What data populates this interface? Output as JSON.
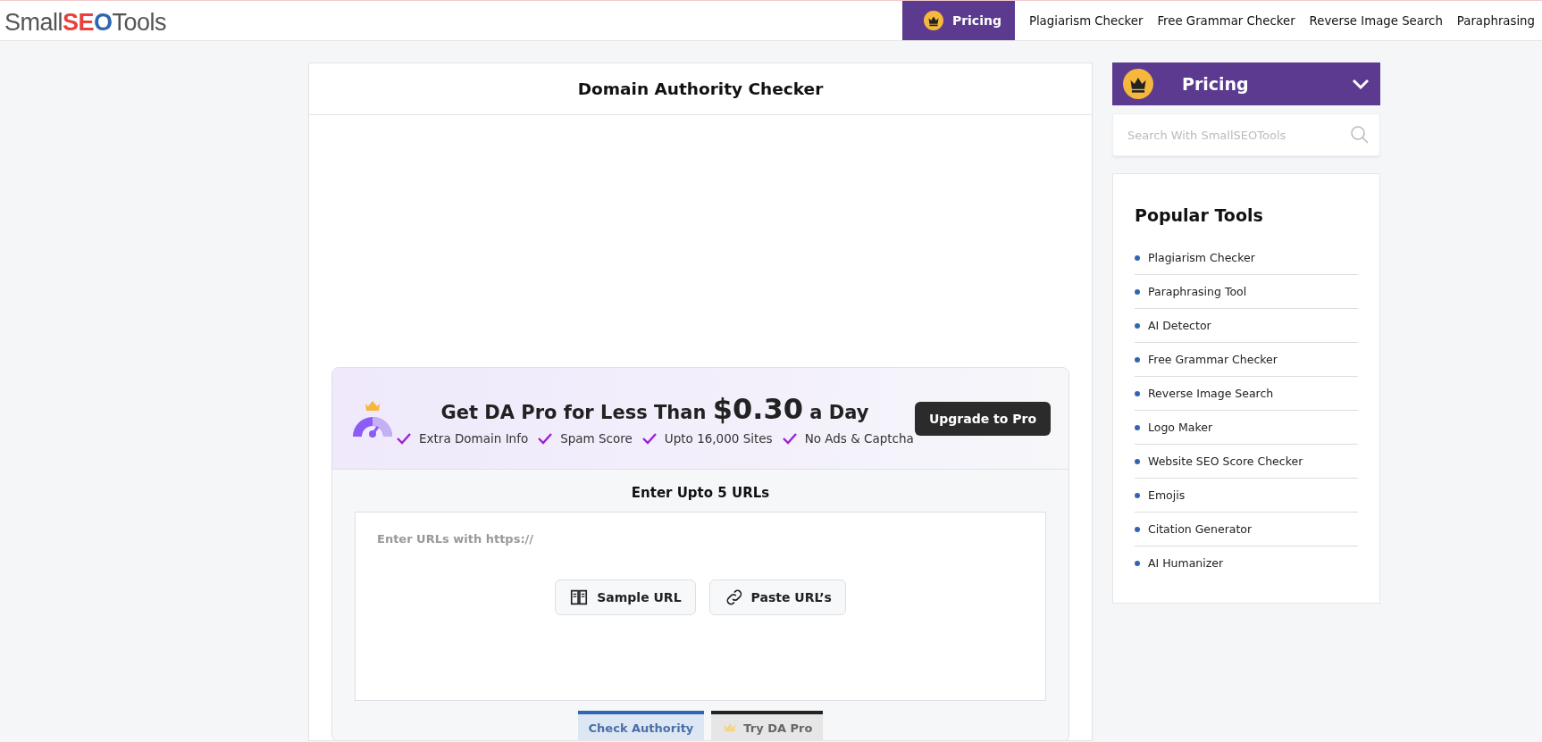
{
  "header": {
    "logo": {
      "lead": "Small",
      "mark": "SEO",
      "tail": "Tools"
    },
    "pricing": "Pricing",
    "nav": [
      "Plagiarism Checker",
      "Free Grammar Checker",
      "Reverse Image Search",
      "Paraphrasing"
    ]
  },
  "main": {
    "title": "Domain Authority Checker",
    "promo": {
      "headline_before": "Get DA Pro for Less Than",
      "price": "$0.30",
      "headline_after": "a Day",
      "features": [
        "Extra Domain Info",
        "Spam Score",
        "Upto 16,000 Sites",
        "No Ads & Captcha"
      ],
      "button": "Upgrade to Pro"
    },
    "input_label": "Enter Upto 5 URLs",
    "input": {
      "placeholder": "Enter URLs with https://"
    },
    "helpers": [
      {
        "kind": "sample",
        "label": "Sample URL"
      },
      {
        "kind": "paste",
        "label": "Paste URL’s"
      }
    ],
    "actions": [
      {
        "kind": "check",
        "label": "Check Authority"
      },
      {
        "kind": "pro",
        "label": "Try DA Pro"
      }
    ]
  },
  "sidebar": {
    "pricing": "Pricing",
    "search": {
      "placeholder": "Search With SmallSEOTools"
    },
    "popular_title": "Popular Tools",
    "tools": [
      "Plagiarism Checker",
      "Paraphrasing Tool",
      "AI Detector",
      "Free Grammar Checker",
      "Reverse Image Search",
      "Logo Maker",
      "Website SEO Score Checker",
      "Emojis",
      "Citation Generator",
      "AI Humanizer"
    ]
  }
}
